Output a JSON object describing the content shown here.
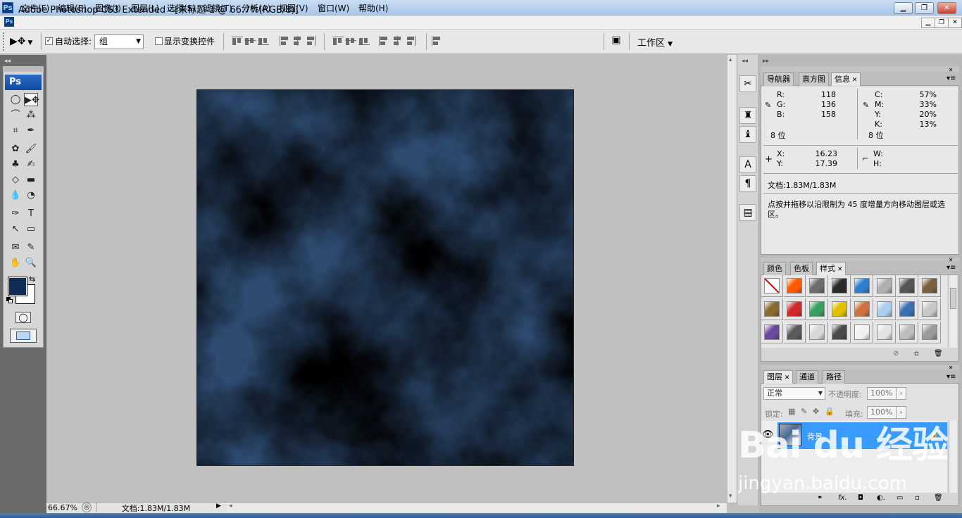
{
  "window": {
    "app_icon_label": "Ps",
    "title": "Adobe Photoshop CS3 Extended - [未标题-1 @ 66.7%(RGB/8)]",
    "minimize_glyph": "▁",
    "restore_glyph": "❐",
    "close_glyph": "✕"
  },
  "menu": [
    "文件(F)",
    "编辑(E)",
    "图像(I)",
    "图层(L)",
    "选择(S)",
    "滤镜(T)",
    "分析(A)",
    "视图(V)",
    "窗口(W)",
    "帮助(H)"
  ],
  "options_bar": {
    "auto_select_label": "自动选择:",
    "auto_select_checked": true,
    "auto_select_value": "组",
    "show_transform_label": "显示变换控件",
    "show_transform_checked": false,
    "workspace_label": "工作区"
  },
  "toolbox": {
    "logo": "Ps",
    "foreground_color": "#0f2d55",
    "background_color": "#ffffff"
  },
  "document": {
    "filter": "clouds",
    "base_color": "#2e4c72",
    "highlight_color": "#e8edf4"
  },
  "status_bar": {
    "zoom": "66.67%",
    "doc_info": "文档:1.83M/1.83M"
  },
  "info_panel": {
    "tabs": [
      "导航器",
      "直方图",
      "信息"
    ],
    "active_tab": "信息",
    "rgb": {
      "R": "118",
      "G": "136",
      "B": "158"
    },
    "cmyk": {
      "C": "57%",
      "M": "33%",
      "Y": "20%",
      "K": "13%"
    },
    "bit_depth_left": "8 位",
    "bit_depth_right": "8 位",
    "x": "16.23",
    "y": "17.39",
    "w": "",
    "h": "",
    "doc_size": "文档:1.83M/1.83M",
    "hint": "点按并拖移以沿限制为 45 度增量方向移动图层或选区。"
  },
  "styles_panel": {
    "tabs": [
      "颜色",
      "色板",
      "样式"
    ],
    "active_tab": "样式",
    "swatches": [
      [
        "none",
        "#ff5a00",
        "#6c6c6c",
        "#2a2a2a",
        "#2f7fcf",
        "#b0b0b0",
        "#555555",
        "#7a6040"
      ],
      [
        "#8a6a30",
        "#d22a2a",
        "#3aa060",
        "#e2c000",
        "#d07040",
        "#a8cff0",
        "#3a70b0",
        "#c8c8c8"
      ],
      [
        "#6a4aa0",
        "#5a5a5a",
        "#d8d8d8",
        "#4a4a4a",
        "#f0f0f0",
        "#e4e4e4",
        "#bdbdbd",
        "#9a9a9a"
      ]
    ]
  },
  "layers_panel": {
    "tabs": [
      "图层",
      "通道",
      "路径"
    ],
    "active_tab": "图层",
    "blend_mode": "正常",
    "opacity_label": "不透明度:",
    "opacity_value": "100%",
    "lock_label": "锁定:",
    "fill_label": "填充:",
    "fill_value": "100%",
    "layers": [
      {
        "name": "背景",
        "visible": true,
        "locked": true
      }
    ]
  },
  "watermark": {
    "logo": "Bai du 经验",
    "url": "jingyan.baidu.com"
  }
}
